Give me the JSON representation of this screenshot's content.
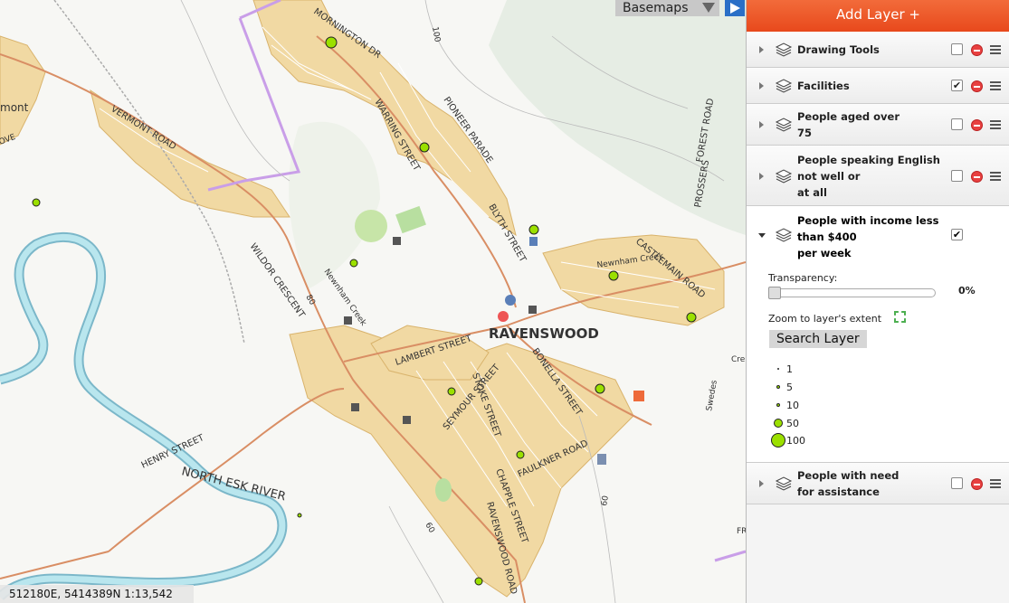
{
  "map": {
    "basemaps_label": "Basemaps",
    "coordinates": "512180E, 5414389N 1:13,542",
    "labels": {
      "town": "RAVENSWOOD",
      "river": "NORTH ESK RIVER",
      "creek1": "Newnham Creek",
      "creek2": "Newnham Creek",
      "creek3": "Swedes",
      "mornington": "MORNINGTON DR",
      "warring": "WARRING STREET",
      "pioneer": "PIONEER PARADE",
      "blyth": "BLYTH STREET",
      "vermont": "VERMONT ROAD",
      "vermont_left": "mont",
      "grove": "OVE",
      "wildor": "WILDOR CRESCENT",
      "lambert": "LAMBERT STREET",
      "stoke": "STOKE STREET",
      "seymour": "SEYMOUR STREET",
      "bonella": "BONELLA STREET",
      "castlemain": "CASTLEMAIN ROAD",
      "faulkner": "FAULKNER ROAD",
      "chapple": "CHAPPLE STREET",
      "ravenswood_rd": "RAVENSWOOD ROAD",
      "henry": "HENRY STREET",
      "forest": "FOREST ROAD",
      "prossers": "PROSSERS",
      "contour_100": "100",
      "contour_80": "80",
      "contour_60": "60",
      "contour_60b": "60",
      "cre": "Cre",
      "frg": "FRC"
    },
    "point_color": "#9be000"
  },
  "panel": {
    "add_layer_label": "Add Layer +",
    "layers": [
      {
        "title": "Drawing Tools",
        "checked": false
      },
      {
        "title": "Facilities",
        "checked": true
      },
      {
        "title_lines": [
          "People aged over",
          "75"
        ],
        "checked": false
      },
      {
        "title_lines": [
          "People speaking English",
          "not well or",
          "at all"
        ],
        "checked": false
      },
      {
        "title_lines": [
          "People with income less",
          "than $400",
          "per week"
        ],
        "checked": true
      },
      {
        "title_lines": [
          "People with need",
          "for assistance"
        ],
        "checked": false
      }
    ],
    "checkmark": "✔",
    "transparency_label": "Transparency:",
    "transparency_value": "0%",
    "zoom_label": "Zoom to layer's extent",
    "search_layer_label": "Search Layer",
    "legend": [
      "1",
      "5",
      "10",
      "50",
      "100"
    ]
  }
}
